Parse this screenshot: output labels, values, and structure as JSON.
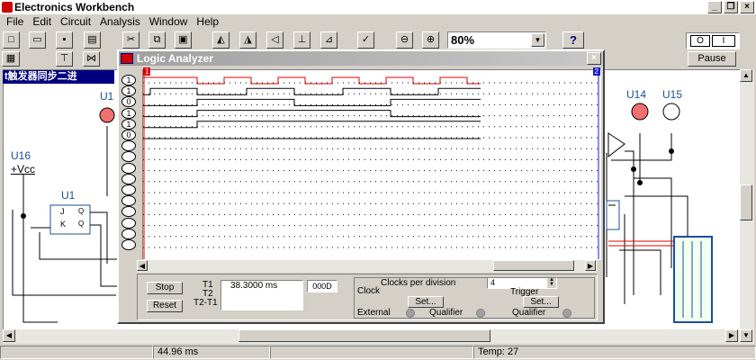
{
  "app": {
    "title": "Electronics Workbench"
  },
  "menu": [
    {
      "label": "File"
    },
    {
      "label": "Edit"
    },
    {
      "label": "Circuit"
    },
    {
      "label": "Analysis"
    },
    {
      "label": "Window"
    },
    {
      "label": "Help"
    }
  ],
  "toolbar": {
    "zoom": "80%",
    "help": "?",
    "pause": "Pause",
    "power_on": "I",
    "power_off": "O"
  },
  "circuit": {
    "title": "t触发器同步二进",
    "labels": [
      "U16",
      "+Vcc",
      "U1",
      "U14",
      "U15",
      "U1"
    ],
    "chip_pins": [
      "J",
      "K",
      "Q",
      "Q"
    ]
  },
  "analyzer": {
    "title": "Logic Analyzer",
    "channels": [
      "1",
      "1",
      "0",
      "1",
      "1",
      "0",
      "",
      "",
      "",
      "",
      "",
      "",
      "",
      "",
      "",
      ""
    ],
    "stop": "Stop",
    "reset": "Reset",
    "t1_label": "T1",
    "t2_label": "T2",
    "t21_label": "T2-T1",
    "t1_value": "38.3000 ms",
    "t1_hex": "000D",
    "clocks_label": "Clocks per division",
    "clocks_value": "4",
    "clock_label": "Clock",
    "trigger_label": "Trigger",
    "set_label": "Set...",
    "external_label": "External",
    "qualifier_label": "Qualifier",
    "marker1": "1",
    "marker2": "2"
  },
  "status": {
    "time": "44.96 ms",
    "temp": "Temp:  27"
  },
  "colors": {
    "signal_red": "#e00000",
    "signal_black": "#000000",
    "title_blue": "#000080"
  }
}
